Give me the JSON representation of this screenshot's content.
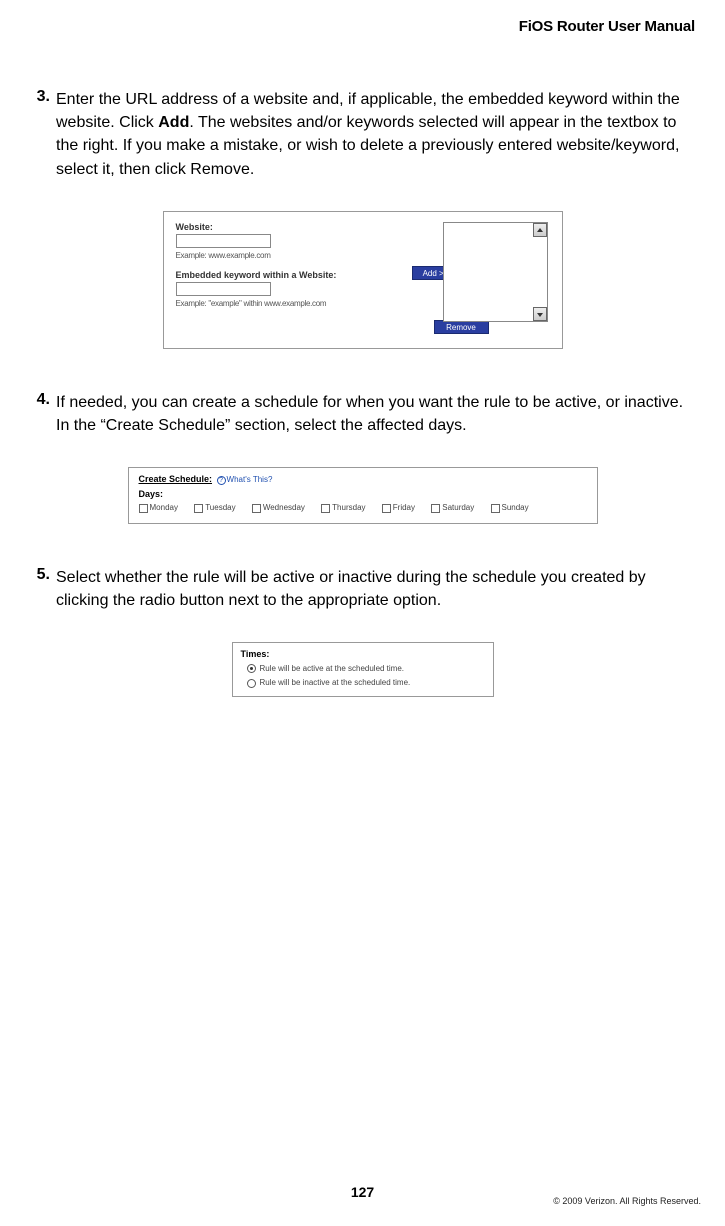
{
  "header": {
    "title": "FiOS Router User Manual"
  },
  "steps": [
    {
      "num": "3.",
      "text_before": "Enter the URL address of a website and, if applicable, the embedded keyword within the website. Click ",
      "bold": "Add",
      "text_after": ". The websites and/or keywords selected will appear in the textbox to the right. If you make a mistake, or wish to delete a previously entered website/keyword, select it, then click Remove."
    },
    {
      "num": "4.",
      "text": "If needed, you can create a schedule for when you want the rule to be active, or inactive. In the “Create Schedule” section, select the affected days."
    },
    {
      "num": "5.",
      "text": "Select whether the rule will be active or inactive during the schedule you created by clicking the radio button next to the appropriate option."
    }
  ],
  "fig1": {
    "website_label": "Website:",
    "website_hint": "Example: www.example.com",
    "keyword_label": "Embedded keyword within a Website:",
    "keyword_hint": "Example: \"example\" within www.example.com",
    "add_btn": "Add >>",
    "remove_btn": "Remove"
  },
  "fig2": {
    "title": "Create Schedule:",
    "help_text": "What's This?",
    "days_label": "Days:",
    "days": [
      "Monday",
      "Tuesday",
      "Wednesday",
      "Thursday",
      "Friday",
      "Saturday",
      "Sunday"
    ]
  },
  "fig3": {
    "times_label": "Times:",
    "opt_active": "Rule will be active at the scheduled time.",
    "opt_inactive": "Rule will be inactive at the scheduled time."
  },
  "page_number": "127",
  "copyright": "© 2009 Verizon. All Rights Reserved."
}
